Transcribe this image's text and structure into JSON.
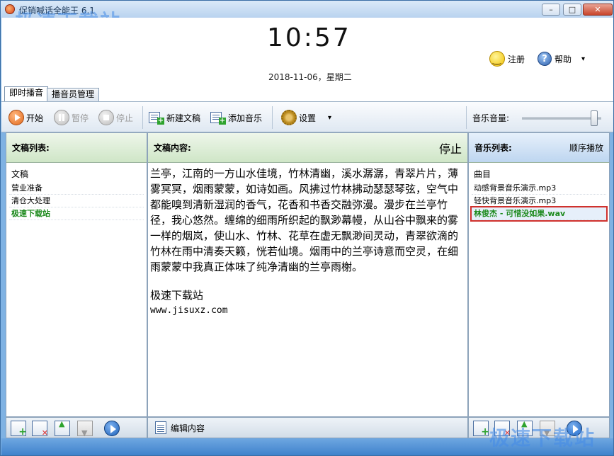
{
  "window": {
    "title": "促销喊话全能王 6.1",
    "watermark": "极速下载站"
  },
  "header": {
    "time": "10:57",
    "date": "2018-11-06，星期二",
    "register_label": "注册",
    "help_label": "帮助",
    "menu_caret": "▾"
  },
  "tabs": [
    {
      "label": "即时播音"
    },
    {
      "label": "播音员管理"
    }
  ],
  "toolbar": {
    "start": "开始",
    "pause": "暂停",
    "stop": "停止",
    "new_doc": "新建文稿",
    "add_music": "添加音乐",
    "settings": "设置",
    "settings_caret": "▾",
    "volume_label": "音乐音量:",
    "volume_level": 0.95
  },
  "left_panel": {
    "title": "文稿列表:",
    "column_header": "文稿",
    "items": [
      "营业准备",
      "清仓大处理",
      "极速下载站"
    ],
    "selected_index": 2
  },
  "middle_panel": {
    "title": "文稿内容:",
    "status": "停止",
    "body": "兰亭，江南的一方山水佳境，竹林清幽，溪水潺潺，青翠片片，薄雾冥冥，烟雨蒙蒙，如诗如画。风拂过竹林拂动瑟瑟琴弦，空气中都能嗅到清新湿润的香气，花香和书香交融弥漫。漫步在兰亭竹径，我心悠然。缠绵的细雨所织起的飘渺幕幔，从山谷中飘来的雾一样的烟岚，使山水、竹林、花草在虚无飘渺间灵动，青翠欲滴的竹林在雨中清奏天籁，恍若仙境。烟雨中的兰亭诗意而空灵，在细雨蒙蒙中我真正体味了纯净清幽的兰亭雨榭。",
    "sign": "极速下载站",
    "url": "www.jisuxz.com",
    "edit_label": "编辑内容"
  },
  "right_panel": {
    "title": "音乐列表:",
    "mode": "顺序播放",
    "column_header": "曲目",
    "items": [
      "动感背景音乐演示.mp3",
      "轻快背景音乐演示.mp3",
      "林俊杰 - 可惜没如果.wav"
    ],
    "selected_index": 2
  }
}
